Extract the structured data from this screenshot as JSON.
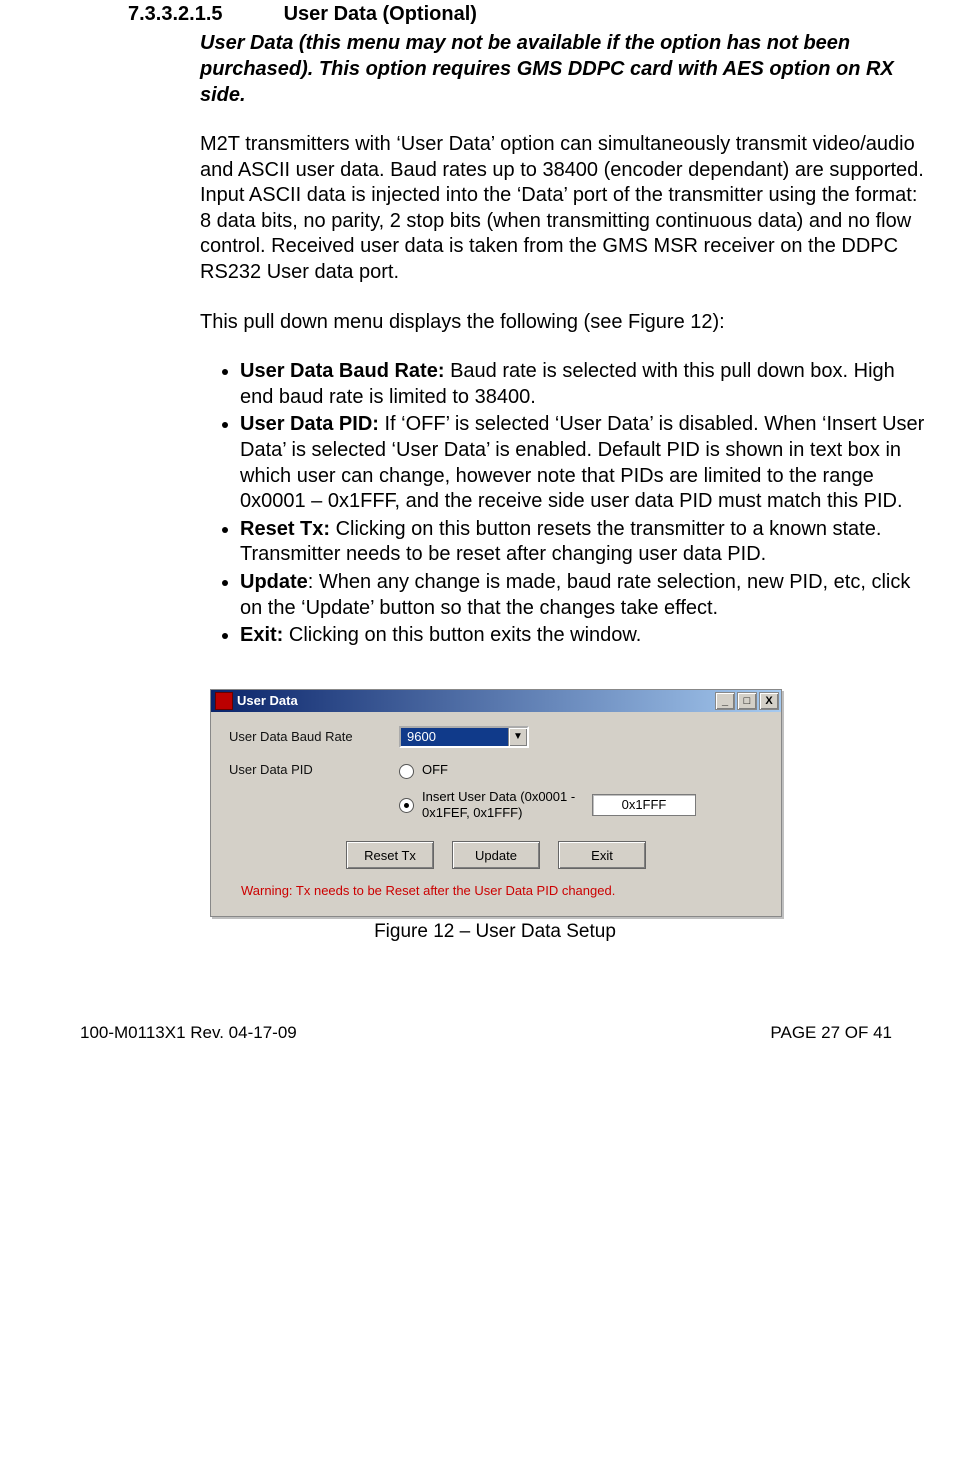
{
  "section": {
    "number": "7.3.3.2.1.5",
    "title": "User Data (Optional)"
  },
  "intro_italic": "User Data (this menu may not be available if the option has not been purchased).  This option requires GMS DDPC card with AES option on RX side.",
  "para1": "M2T transmitters with ‘User Data’ option can simultaneously transmit video/audio and ASCII user data. Baud rates up to 38400 (encoder dependant) are supported. Input ASCII data is injected into the ‘Data’ port of the transmitter using the format: 8 data bits, no parity, 2 stop bits (when transmitting continuous data) and no flow control. Received user data is taken from the GMS MSR receiver on the DDPC RS232 User data port.",
  "para2": "This pull down menu displays the following (see Figure 12):",
  "bullets": [
    {
      "label": "User Data Baud Rate:",
      "text": " Baud rate is selected with this pull down box. High end baud rate is limited to 38400."
    },
    {
      "label": "User Data PID:",
      "text": " If ‘OFF’ is selected ‘User Data’ is disabled. When ‘Insert User Data’ is selected ‘User Data’ is enabled. Default PID is shown in text box in which user can change, however note that PIDs are limited to the range 0x0001 – 0x1FFF, and the receive side user data PID must match this PID."
    },
    {
      "label": "Reset Tx:",
      "text": " Clicking on this button resets the transmitter to a known state. Transmitter needs to be reset after changing user data PID."
    },
    {
      "label": "Update",
      "text": ": When any change is made, baud rate selection, new PID, etc, click on the ‘Update’ button so that the changes take effect."
    },
    {
      "label": "Exit:",
      "text": " Clicking on this button exits the window."
    }
  ],
  "dialog": {
    "title": "User Data",
    "labels": {
      "baud": "User Data Baud Rate",
      "pid": "User Data PID"
    },
    "baud_value": "9600",
    "radio_off": "OFF",
    "radio_insert": "Insert User Data (0x0001 - 0x1FEF, 0x1FFF)",
    "pid_value": "0x1FFF",
    "buttons": {
      "reset": "Reset Tx",
      "update": "Update",
      "exit": "Exit"
    },
    "warning": "Warning: Tx needs to be Reset after the User Data PID changed.",
    "titlebar_icons": {
      "min": "_",
      "max": "□",
      "close": "X"
    }
  },
  "figure_caption": "Figure 12 – User Data Setup",
  "footer": {
    "left": "100-M0113X1 Rev. 04-17-09",
    "right": "PAGE 27 OF 41"
  }
}
